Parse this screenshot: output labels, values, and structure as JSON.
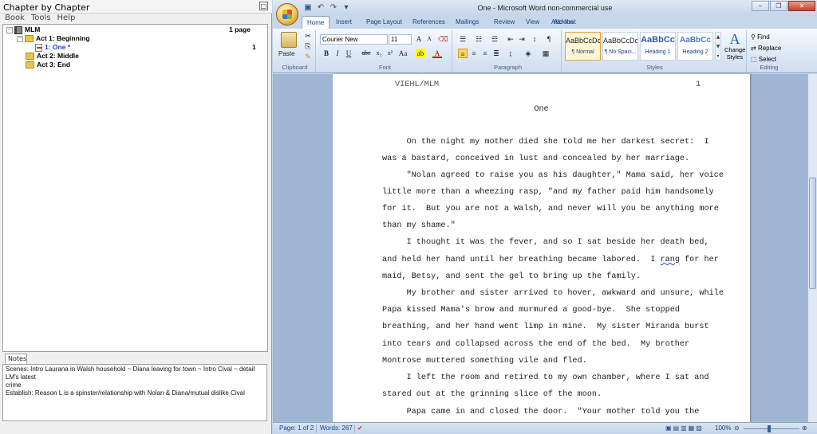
{
  "left": {
    "title": "Chapter by Chapter",
    "menu": [
      "Book",
      "Tools",
      "Help"
    ],
    "tree": {
      "book": {
        "name": "MLM",
        "count": "1 page"
      },
      "acts": [
        {
          "name": "Act 1: Beginning",
          "children": [
            {
              "name": "1: One *",
              "count": "1"
            }
          ]
        },
        {
          "name": "Act 2: Middle"
        },
        {
          "name": "Act 3: End"
        }
      ]
    },
    "notes_tab": "Notes",
    "notes_text": [
      "Scenes:  Intro Laurana in Walsh household ~ Diana leaving for town ~ Intro Cival ~ detail LM's latest",
      "crime",
      "Establish:  Reason L is a spinster/relationship with Nolan & Diana/mutual dislike Cival"
    ]
  },
  "word": {
    "title": "One - Microsoft Word non-commercial use",
    "tabs": [
      "Home",
      "Insert",
      "Page Layout",
      "References",
      "Mailings",
      "Review",
      "View",
      "Add-Ins",
      "Acrobat"
    ],
    "font": {
      "name": "Courier New",
      "size": "11"
    },
    "groups": {
      "clipboard": "Clipboard",
      "font": "Font",
      "paragraph": "Paragraph",
      "styles": "Styles",
      "editing": "Editing"
    },
    "paste_label": "Paste",
    "styles": [
      {
        "preview": "AaBbCcDc",
        "name": "¶ Normal"
      },
      {
        "preview": "AaBbCcDc",
        "name": "¶ No Spaci..."
      },
      {
        "preview": "AaBbCc",
        "name": "Heading 1"
      },
      {
        "preview": "AaBbCc",
        "name": "Heading 2"
      }
    ],
    "change_styles": [
      "Change",
      "Styles"
    ],
    "editing": {
      "find": "Find",
      "replace": "Replace",
      "select": "Select"
    }
  },
  "document": {
    "header_left": "VIEHL/MLM",
    "header_right": "1",
    "title": "One",
    "lines": [
      "     On the night my mother died she told me her darkest secret:  I",
      "was a bastard, conceived in lust and concealed by her marriage.",
      "     \"Nolan agreed to raise you as his daughter,\" Mama said, her voice",
      "little more than a wheezing rasp, \"and my father paid him handsomely",
      "for it.  But you are not a Walsh, and never will you be anything more",
      "than my shame.\"",
      "     I thought it was the fever, and so I sat beside her death bed,",
      "and held her hand until her breathing became labored.  I ",
      "maid, Betsy, and sent the gel to bring up the family.",
      "     My brother and sister arrived to hover, awkward and unsure, while",
      "Papa kissed Mama's brow and murmured a good-bye.  She stopped",
      "breathing, and her hand went limp in mine.  My sister Miranda burst",
      "into tears and collapsed across the end of the bed.  My brother",
      "Montrose muttered something vile and fled.",
      "     I left the room and retired to my own chamber, where I sat and",
      "stared out at the grinning slice of the moon.",
      "     Papa came in and closed the door.  \"Your mother told you the"
    ],
    "misspelled_word": "rang",
    "line8_tail": " for her"
  },
  "status": {
    "page": "Page: 1 of 2",
    "words": "Words: 267",
    "zoom": "100%"
  }
}
